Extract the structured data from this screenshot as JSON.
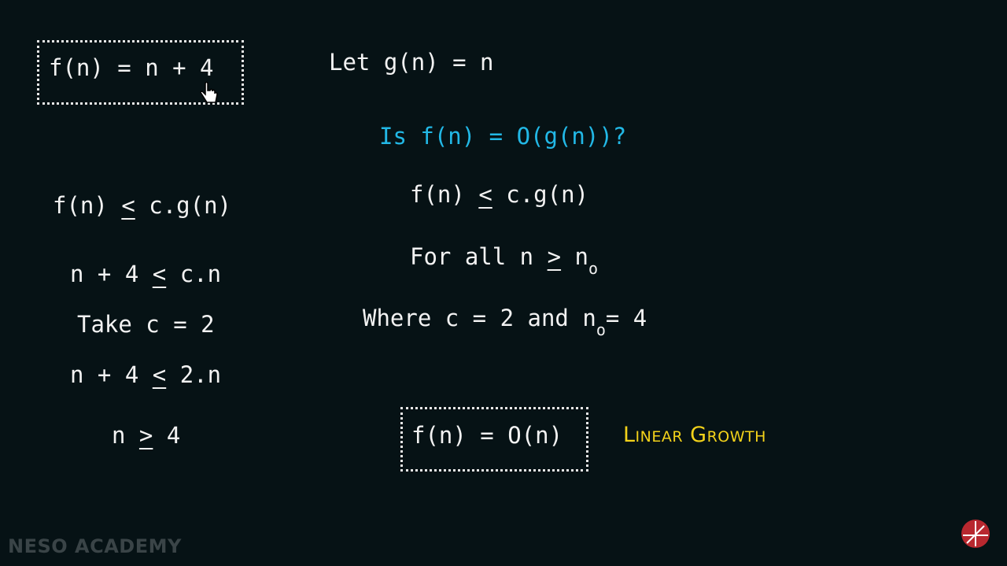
{
  "top": {
    "boxed_fn": [
      "f(n) = n + 4"
    ],
    "let_g": "Let g(n) = n"
  },
  "question": "Is f(n) = O(g(n))?",
  "left_steps": {
    "s1_a": "f(n) ",
    "s1_op": "<",
    "s1_b": " c.g(n)",
    "s2_a": "n + 4 ",
    "s2_op": "<",
    "s2_b": " c.n",
    "s3": "Take c = 2",
    "s4_a": "n + 4 ",
    "s4_op": "<",
    "s4_b": " 2.n",
    "s5_a": "n ",
    "s5_op": ">",
    "s5_b": " 4"
  },
  "right_steps": {
    "r1_a": "f(n) ",
    "r1_op": "<",
    "r1_b": " c.g(n)",
    "r2_a": "For all n ",
    "r2_op": ">",
    "r2_b": " n",
    "r2_sub": "o",
    "r3_a": "Where c = 2 and n",
    "r3_sub": "o",
    "r3_b": "= 4"
  },
  "result": {
    "boxed": "f(n) = O(n)",
    "label": "Linear Growth"
  },
  "watermark": "NESO ACADEMY",
  "colors": {
    "background": "#061215",
    "question": "#22b8e6",
    "label": "#f3d21a",
    "text": "#f2f2f2"
  },
  "icons": [
    "hand-pointer-icon",
    "neso-logo-icon"
  ]
}
